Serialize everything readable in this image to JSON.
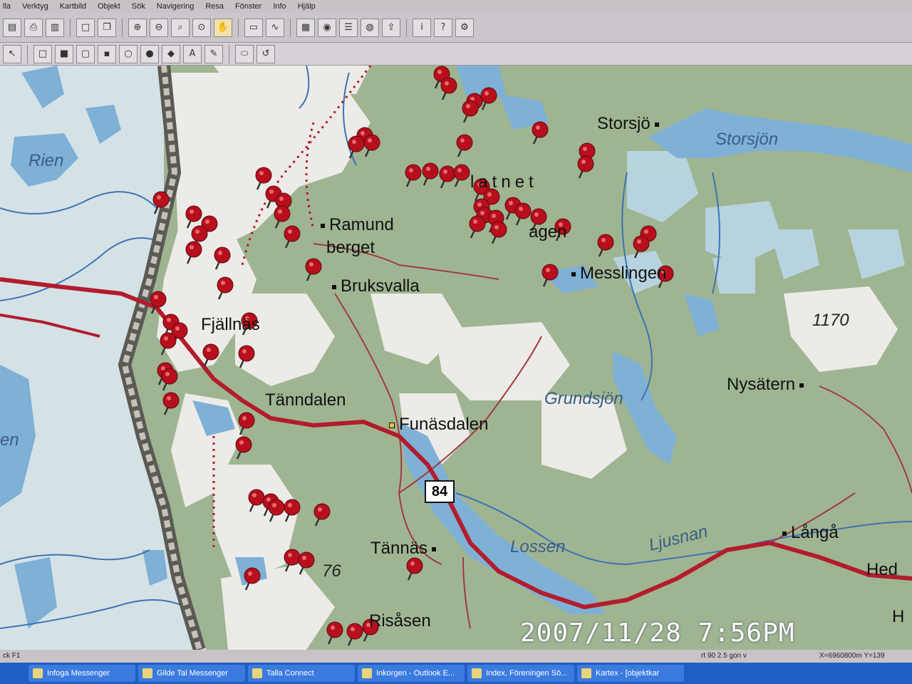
{
  "menu": [
    "lla",
    "Verktyg",
    "Kartbild",
    "Objekt",
    "Sök",
    "Navigering",
    "Resa",
    "Fönster",
    "Info",
    "Hjälp"
  ],
  "toolbar1_icons": [
    "open-icon",
    "print-icon",
    "preview-icon",
    "blank-icon",
    "copy-icon",
    "zoom-in-icon",
    "zoom-out-icon",
    "zoom-icon",
    "zoom-area-icon",
    "pan-hand-icon",
    "scale-icon",
    "measure-icon",
    "layers-icon",
    "find-icon",
    "list-icon",
    "globe-icon",
    "export-icon",
    "info-icon",
    "help-icon",
    "settings-icon"
  ],
  "toolbar2_icons": [
    "pointer-icon",
    "rectangle-icon",
    "filled-rectangle-icon",
    "rounded-rect-icon",
    "filled-rounded-rect-icon",
    "circle-icon",
    "filled-circle-icon",
    "polygon-icon",
    "text-icon",
    "pen-icon",
    "ellipse-icon",
    "undo-icon"
  ],
  "map": {
    "places": {
      "ramundberget_1": "Ramund",
      "ramundberget_2": "berget",
      "bruksvallarna": "Bruksvalla",
      "fjallnas": "Fjällnäs",
      "tanndalen": "Tänndalen",
      "funasdalen": "Funäsdalen",
      "messlingen": "Messlingen",
      "nysatern": "Nysätern",
      "storsjo": "Storsjö",
      "tannas": "Tännäs",
      "risasen": "Risåsen",
      "langa": "Långå",
      "hede": "Hed",
      "hede2": "H",
      "ljusnedal": "agen",
      "latnet": "latnet"
    },
    "water": {
      "storsjon": "Storsjön",
      "rien": "Rien",
      "grundsjon": "Grundsjön",
      "lossen": "Lossen",
      "ljusnan": "Ljusnan",
      "partial_west": "en"
    },
    "elevations": {
      "e1170": "1170",
      "e76": "76"
    },
    "road_sign": "84"
  },
  "timestamp": "2007/11/28  7:56PM",
  "status": {
    "left": "ck F1",
    "scale": "rt 90 2.5 gon v",
    "coords": "X=6960800m Y=139"
  },
  "taskbar": [
    "Infoga Messenger",
    "Gilde Tal Messenger",
    "Talla Connect",
    "Inkorgen - Outlook E...",
    "Index, Föreningen Sö...",
    "Kartex - [objektkar"
  ],
  "colors": {
    "road": "#b21c2d",
    "pin": "#b80f1c",
    "forest": "#9fb592",
    "water": "#7fb0d6",
    "fell": "#efefec"
  }
}
